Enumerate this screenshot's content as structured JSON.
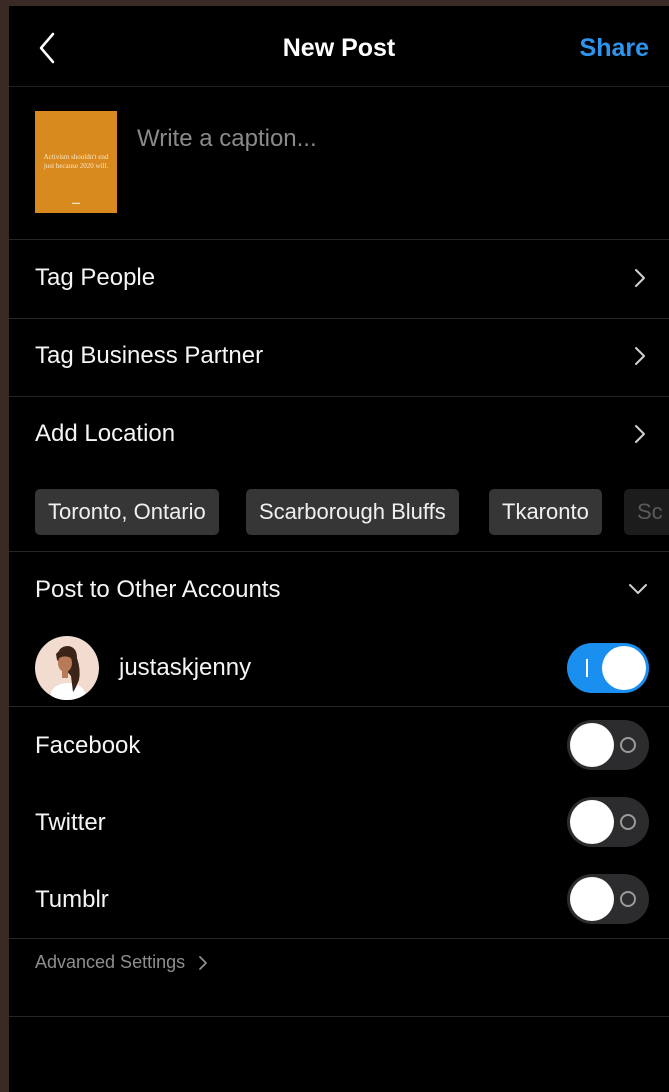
{
  "header": {
    "back_icon": "chevron-left-icon",
    "title": "New Post",
    "share_label": "Share",
    "accent_color": "#2d95ed"
  },
  "caption": {
    "placeholder": "Write a caption...",
    "thumbnail_text": "Activism shouldn't end just because 2020 will.",
    "thumbnail_color": "#d98a1e"
  },
  "menu": {
    "tag_people": "Tag People",
    "tag_business_partner": "Tag Business Partner",
    "add_location": "Add Location"
  },
  "locations": [
    "Toronto, Ontario",
    "Scarborough Bluffs",
    "Tkaronto",
    "Sc"
  ],
  "post_to_other": {
    "title": "Post to Other Accounts",
    "account": {
      "name": "justaskjenny",
      "enabled": true
    },
    "facebook": {
      "label": "Facebook",
      "enabled": false
    },
    "twitter": {
      "label": "Twitter",
      "enabled": false
    },
    "tumblr": {
      "label": "Tumblr",
      "enabled": false
    }
  },
  "advanced_settings": "Advanced Settings"
}
